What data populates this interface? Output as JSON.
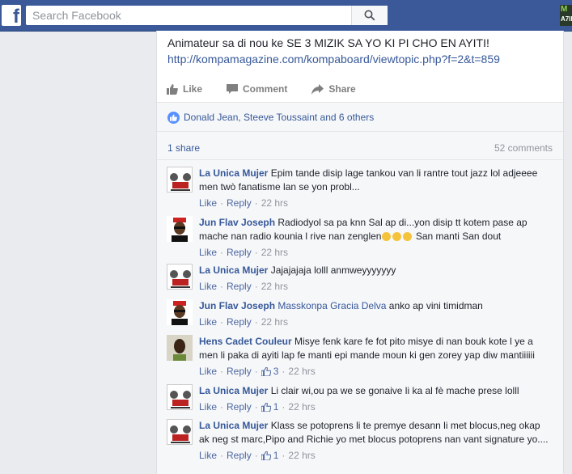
{
  "search": {
    "placeholder": "Search Facebook"
  },
  "logo": {
    "letter": "f"
  },
  "corner": {
    "line1": "M",
    "line2": "A7IN"
  },
  "post": {
    "text": "Animateur sa di nou ke SE 3 MIZIK SA YO KI PI CHO EN AYITI!",
    "link": "http://kompamagazine.com/kompaboard/viewtopic.php?f=2&t=859"
  },
  "actions": {
    "like": "Like",
    "comment": "Comment",
    "share": "Share"
  },
  "likes": {
    "text": "Donald Jean, Steeve Toussaint and 6 others"
  },
  "stats": {
    "shares": "1 share",
    "comments": "52 comments"
  },
  "meta": {
    "like": "Like",
    "reply": "Reply"
  },
  "comments": [
    {
      "name": "La Unica Mujer",
      "text": "Epim tande disip lage tankou van li rantre tout jazz lol adjeeee men twò fanatisme lan se yon probl...",
      "time": "22 hrs"
    },
    {
      "name": "Jun Flav Joseph",
      "text": "Radiodyol sa pa knn Sal ap di...yon disip tt kotem pase ap mache nan radio kounia l rive nan zenglen",
      "text2": "San manti San dout",
      "time": "22 hrs"
    },
    {
      "name": "La Unica Mujer",
      "text": "Jajajajaja lolll anmweyyyyyyy",
      "time": "22 hrs"
    },
    {
      "name": "Jun Flav Joseph",
      "tag": "Masskonpa Gracia Delva",
      "text": "anko ap vini timidman",
      "time": "22 hrs"
    },
    {
      "name": "Hens Cadet Couleur",
      "text": "Misye fenk kare fe fot pito misye di nan bouk kote l ye a men li paka di ayiti lap fe manti epi mande moun ki gen zorey yap diw mantiiiiii",
      "reactions": "3",
      "time": "22 hrs"
    },
    {
      "name": "La Unica Mujer",
      "text": "Li clair wi,ou pa we se gonaive li ka al fè mache prese lolll",
      "reactions": "1",
      "time": "22 hrs"
    },
    {
      "name": "La Unica Mujer",
      "text": "Klass se potoprens li te premye desann li met blocus,neg okap ak neg st marc,Pipo and Richie yo met blocus potoprens nan vant signature yo....",
      "reactions": "1",
      "time": "22 hrs"
    }
  ],
  "colors": {
    "brand": "#3b5998",
    "link": "#365899",
    "meta": "#90949c"
  }
}
